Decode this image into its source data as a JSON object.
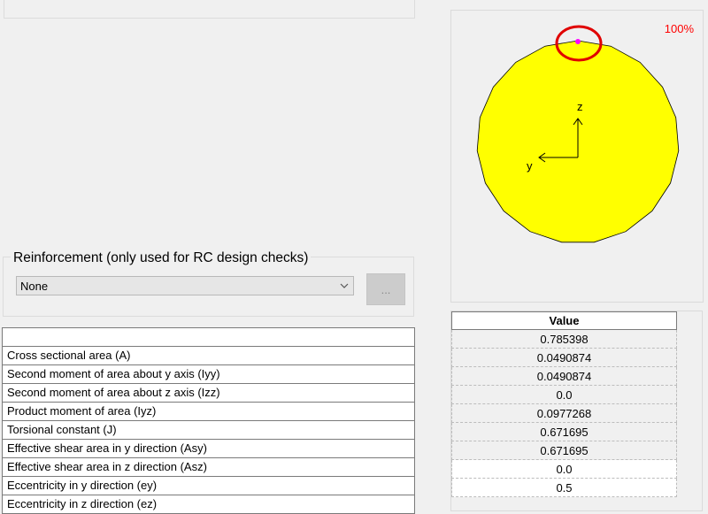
{
  "preview": {
    "zoom": "100%",
    "axis_z": "z",
    "axis_y": "y",
    "colors": {
      "section_fill": "#ffff00",
      "highlight_ring": "#e00000",
      "point": "#ff00ff",
      "zoom_text": "#ff0000"
    }
  },
  "reinforcement": {
    "title": "Reinforcement (only used for RC design checks)",
    "selected": "None",
    "button_label": "..."
  },
  "properties": {
    "rows": [
      {
        "label": ""
      },
      {
        "label": "Cross sectional area (A)"
      },
      {
        "label": "Second moment of area about y axis (Iyy)"
      },
      {
        "label": "Second moment of area about z axis (Izz)"
      },
      {
        "label": "Product moment of area (Iyz)"
      },
      {
        "label": "Torsional constant (J)"
      },
      {
        "label": "Effective shear area in y direction (Asy)"
      },
      {
        "label": "Effective shear area in z direction (Asz)"
      },
      {
        "label": "Eccentricity in y direction (ey)"
      },
      {
        "label": "Eccentricity in z direction (ez)"
      }
    ]
  },
  "values": {
    "header": "Value",
    "rows": [
      {
        "value": "0.785398"
      },
      {
        "value": "0.0490874"
      },
      {
        "value": "0.0490874"
      },
      {
        "value": "0.0"
      },
      {
        "value": "0.0977268"
      },
      {
        "value": "0.671695"
      },
      {
        "value": "0.671695"
      },
      {
        "value": "0.0"
      },
      {
        "value": "0.5"
      }
    ]
  }
}
